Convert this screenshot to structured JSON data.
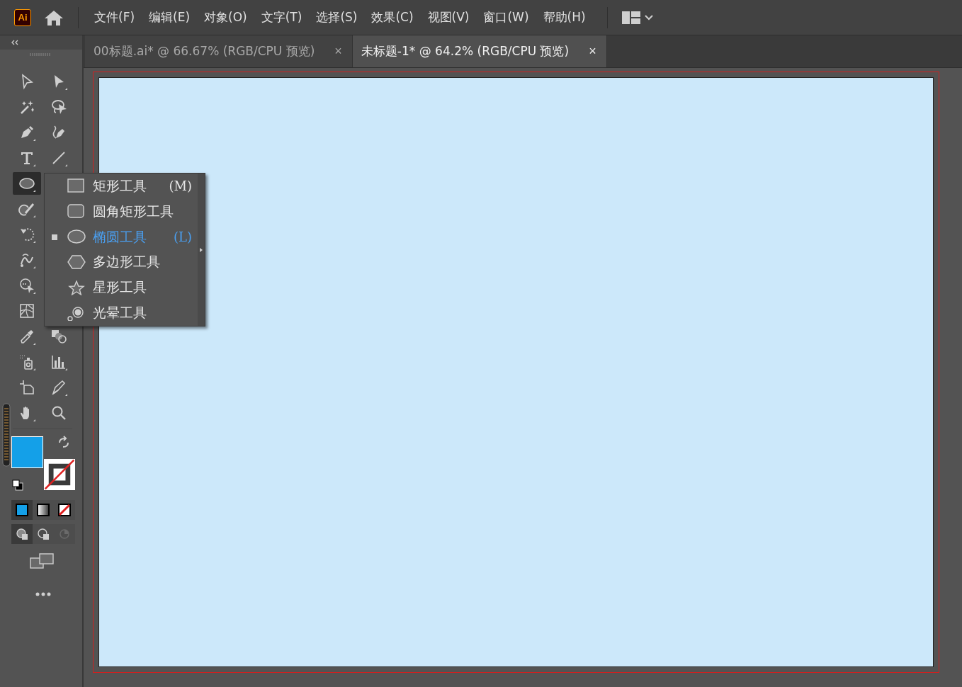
{
  "app_logo": "Ai",
  "menu": [
    "文件(F)",
    "编辑(E)",
    "对象(O)",
    "文字(T)",
    "选择(S)",
    "效果(C)",
    "视图(V)",
    "窗口(W)",
    "帮助(H)"
  ],
  "tabs": [
    {
      "label": "00标题.ai* @ 66.67% (RGB/CPU 预览)",
      "close": "×",
      "selected": false
    },
    {
      "label": "未标题-1* @ 64.2% (RGB/CPU 预览)",
      "close": "×",
      "selected": true
    }
  ],
  "tools": [
    [
      {
        "kind": "selection",
        "selected": false
      },
      {
        "kind": "direct",
        "selected": false
      }
    ],
    [
      {
        "kind": "wand",
        "selected": false
      },
      {
        "kind": "lasso",
        "selected": false
      }
    ],
    [
      {
        "kind": "pen",
        "selected": false
      },
      {
        "kind": "curvature",
        "selected": false
      }
    ],
    [
      {
        "kind": "type",
        "selected": false
      },
      {
        "kind": "line",
        "selected": false
      }
    ],
    [
      {
        "kind": "ellipse",
        "selected": true
      }
    ],
    [
      {
        "kind": "shaper",
        "selected": false
      }
    ],
    [
      {
        "kind": "rotate",
        "selected": false
      }
    ],
    [
      {
        "kind": "puppet",
        "selected": false
      }
    ],
    [
      {
        "kind": "shapebuilder",
        "selected": false
      }
    ],
    [
      {
        "kind": "mesh",
        "selected": false
      }
    ],
    [
      {
        "kind": "eyedropper",
        "selected": false
      },
      {
        "kind": "blend",
        "selected": false
      }
    ],
    [
      {
        "kind": "sprayer",
        "selected": false
      },
      {
        "kind": "graph",
        "selected": false
      }
    ],
    [
      {
        "kind": "artboard",
        "selected": false
      },
      {
        "kind": "slice",
        "selected": false
      }
    ],
    [
      {
        "kind": "hand",
        "selected": false
      },
      {
        "kind": "zoom",
        "selected": false
      }
    ]
  ],
  "flyout": [
    {
      "kind": "rect",
      "label": "矩形工具",
      "shortcut": "(M)",
      "selected": false
    },
    {
      "kind": "rounded",
      "label": "圆角矩形工具",
      "selected": false
    },
    {
      "kind": "ellipse",
      "label": "椭圆工具",
      "shortcut": "(L)",
      "selected": true
    },
    {
      "kind": "polygon",
      "label": "多边形工具",
      "selected": false
    },
    {
      "kind": "star",
      "label": "星形工具",
      "selected": false
    },
    {
      "kind": "flare",
      "label": "光晕工具",
      "selected": false
    }
  ],
  "color_modes": [
    {
      "kind": "color",
      "selected": true
    },
    {
      "kind": "gradient",
      "selected": false
    },
    {
      "kind": "none",
      "selected": false
    }
  ],
  "draw_modes": [
    {
      "kind": "normal",
      "selected": true
    },
    {
      "kind": "behind",
      "selected": false
    },
    {
      "kind": "inside",
      "selected": false
    }
  ]
}
